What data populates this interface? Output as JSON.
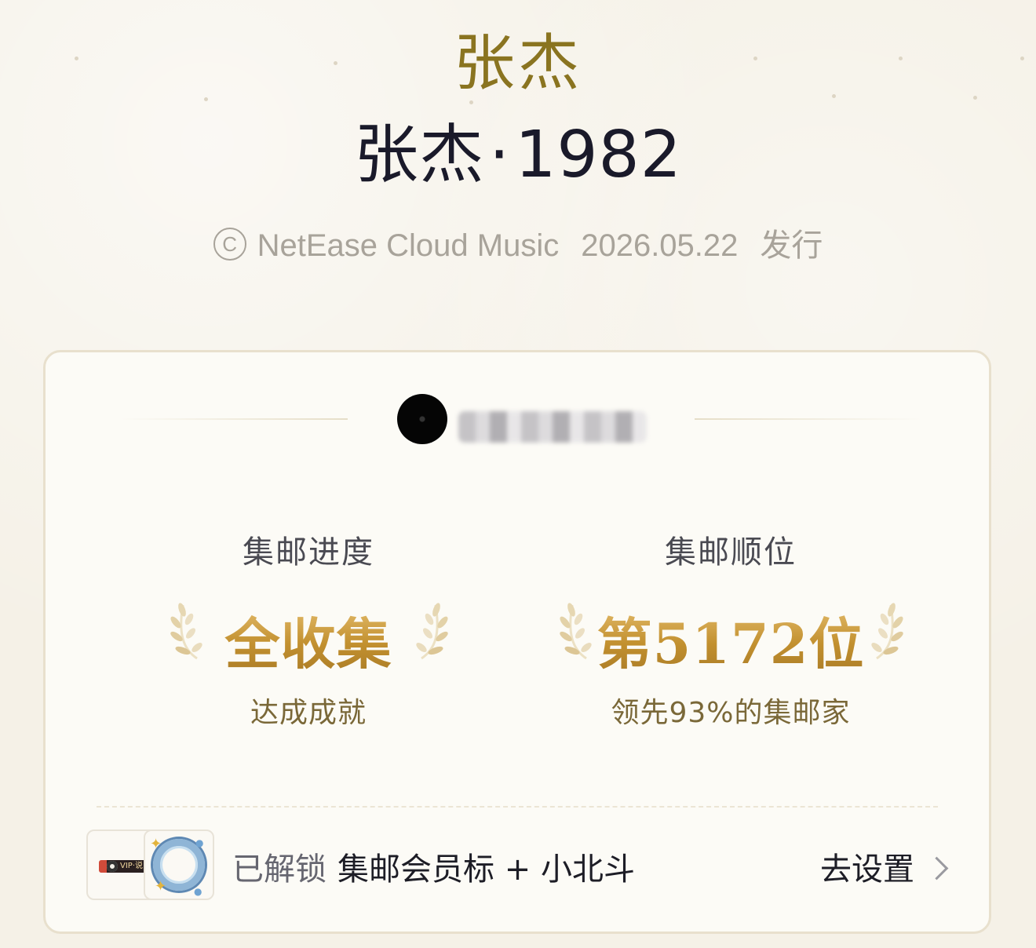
{
  "header": {
    "artist": "张杰",
    "album_name": "张杰",
    "album_separator": "·",
    "album_year": "1982",
    "copyright_symbol": "C",
    "label": "NetEase Cloud Music",
    "release_date": "2026.05.22",
    "release_word": "发行"
  },
  "card": {
    "user": {
      "avatar_icon": "vinyl-record-avatar",
      "username_state": "blurred"
    },
    "progress": {
      "label": "集邮进度",
      "value": "全收集",
      "sub": "达成成就"
    },
    "rank": {
      "label": "集邮顺位",
      "value": "第5172位",
      "sub": "领先93%的集邮家"
    },
    "unlock": {
      "prefix": "已解锁",
      "rewards": "集邮会员标 + 小北斗",
      "action": "去设置",
      "badge_text": "VIP·说",
      "badge_icon": "vip-member-badge-icon",
      "ring_icon": "beidou-ring-icon"
    }
  },
  "colors": {
    "artist": "#8a7420",
    "album": "#1a1a2a",
    "gold": "#c99a3e",
    "sub_text": "#7a6838"
  }
}
